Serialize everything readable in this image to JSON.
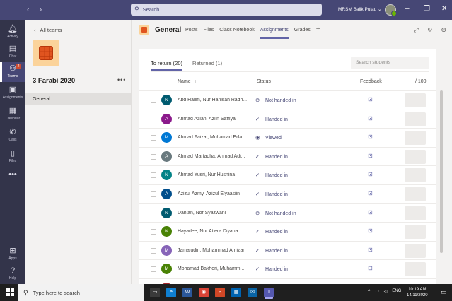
{
  "titlebar": {
    "search_placeholder": "Search",
    "account_name": "MRSM Balik Pulau",
    "icons": [
      "back-icon",
      "forward-icon",
      "search-icon",
      "minimize-icon",
      "maximize-icon",
      "close-icon"
    ]
  },
  "rail": {
    "items": [
      {
        "label": "Activity",
        "icon": "bell-icon"
      },
      {
        "label": "Chat",
        "icon": "chat-icon"
      },
      {
        "label": "Teams",
        "icon": "teams-icon",
        "badge": "2",
        "active": true
      },
      {
        "label": "Assignments",
        "icon": "assignments-icon"
      },
      {
        "label": "Calendar",
        "icon": "calendar-icon"
      },
      {
        "label": "Calls",
        "icon": "phone-icon"
      },
      {
        "label": "Files",
        "icon": "file-icon"
      }
    ],
    "more": "•••",
    "bottom": [
      {
        "label": "Apps",
        "icon": "apps-icon"
      },
      {
        "label": "Help",
        "icon": "help-icon"
      }
    ]
  },
  "team_panel": {
    "back_label": "All teams",
    "team_name": "3 Farabi 2020",
    "more": "•••",
    "channel": "General"
  },
  "channel_header": {
    "title": "General",
    "tabs": [
      "Posts",
      "Files",
      "Class Notebook",
      "Assignments",
      "Grades"
    ],
    "active_tab": "Assignments",
    "add_tab": "+"
  },
  "assignment": {
    "subtabs": {
      "to_return": "To return (20)",
      "returned": "Returned (1)"
    },
    "search_placeholder": "Search students",
    "columns": {
      "name": "Name",
      "name_sort": "↑",
      "status": "Status",
      "feedback": "Feedback",
      "points": "/ 100"
    },
    "students": [
      {
        "initial": "N",
        "color": "#005b70",
        "name": "Abd Halim, Nur Hanisah Radh...",
        "status": "Not handed in",
        "status_icon": "⊘"
      },
      {
        "initial": "A",
        "color": "#8b1a8b",
        "name": "Ahmad Azlan, Azlin Saffiya",
        "status": "Handed in",
        "status_icon": "✓"
      },
      {
        "initial": "M",
        "color": "#0078d4",
        "name": "Ahmad Faizal, Mohamad Erfa...",
        "status": "Viewed",
        "status_icon": "◉"
      },
      {
        "initial": "A",
        "color": "#69797e",
        "name": "Ahmad Martadha, Ahmad Adi...",
        "status": "Handed in",
        "status_icon": "✓"
      },
      {
        "initial": "N",
        "color": "#038387",
        "name": "Ahmad Yusri, Nur Husnina",
        "status": "Handed in",
        "status_icon": "✓"
      },
      {
        "initial": "A",
        "color": "#004e8c",
        "name": "Azizul Azmy, Azizul Elyaasiin",
        "status": "Handed in",
        "status_icon": "✓"
      },
      {
        "initial": "N",
        "color": "#005b70",
        "name": "Dahlan, Nor Syazwani",
        "status": "Not handed in",
        "status_icon": "⊘"
      },
      {
        "initial": "N",
        "color": "#498205",
        "name": "Hayadee, Nur Atiera Diyana",
        "status": "Handed in",
        "status_icon": "✓"
      },
      {
        "initial": "M",
        "color": "#8764b8",
        "name": "Jamaludin, Muhammad Amizan",
        "status": "Handed in",
        "status_icon": "✓"
      },
      {
        "initial": "M",
        "color": "#498205",
        "name": "Mohamad Bakhori, Muhamm...",
        "status": "Handed in",
        "status_icon": "✓"
      },
      {
        "initial": "",
        "color": "#a4262c",
        "name": "",
        "status": "",
        "status_icon": ""
      }
    ]
  },
  "taskbar": {
    "search_placeholder": "Type here to search",
    "apps": [
      {
        "icon": "task-view-icon",
        "color": "#3a3a3a",
        "glyph": "▭"
      },
      {
        "icon": "edge-icon",
        "color": "#0f7fd1",
        "glyph": "e"
      },
      {
        "icon": "word-icon",
        "color": "#2b579a",
        "glyph": "W"
      },
      {
        "icon": "chrome-icon",
        "color": "#db4437",
        "glyph": "◉"
      },
      {
        "icon": "powerpoint-icon",
        "color": "#d24726",
        "glyph": "P"
      },
      {
        "icon": "store-icon",
        "color": "#0063b1",
        "glyph": "▦"
      },
      {
        "icon": "mail-icon",
        "color": "#0a64a4",
        "glyph": "✉"
      },
      {
        "icon": "teams-icon",
        "color": "#5558af",
        "glyph": "T"
      }
    ],
    "language": "ENG",
    "time": "10:19 AM",
    "date": "14/11/2020"
  }
}
